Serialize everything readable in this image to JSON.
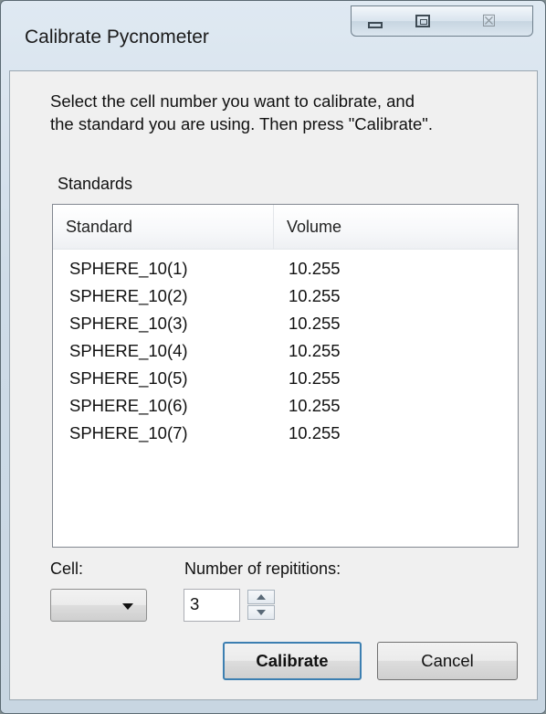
{
  "window": {
    "title": "Calibrate Pycnometer",
    "controls": {
      "minimize": "minimize-icon",
      "maximize": "maximize-icon",
      "close": "close-icon",
      "close_glyph": "☒"
    }
  },
  "instructions": "Select the cell number you want to calibrate, and\nthe standard you are using.  Then press \"Calibrate\".",
  "standards": {
    "group_label": "Standards",
    "columns": [
      "Standard",
      "Volume"
    ],
    "rows": [
      {
        "standard": "SPHERE_10(1)",
        "volume": "10.255"
      },
      {
        "standard": "SPHERE_10(2)",
        "volume": "10.255"
      },
      {
        "standard": "SPHERE_10(3)",
        "volume": "10.255"
      },
      {
        "standard": "SPHERE_10(4)",
        "volume": "10.255"
      },
      {
        "standard": "SPHERE_10(5)",
        "volume": "10.255"
      },
      {
        "standard": "SPHERE_10(6)",
        "volume": "10.255"
      },
      {
        "standard": "SPHERE_10(7)",
        "volume": "10.255"
      }
    ]
  },
  "cell": {
    "label": "Cell:",
    "value": ""
  },
  "repetitions": {
    "label": "Number of repititions:",
    "value": "3"
  },
  "buttons": {
    "calibrate": "Calibrate",
    "cancel": "Cancel"
  }
}
